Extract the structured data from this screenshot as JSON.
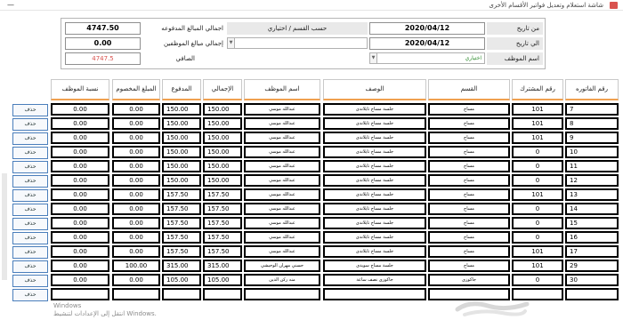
{
  "window": {
    "title": "شاشة استعلام وتعديل فواتير الأقسام الأخرى",
    "minimize": "—"
  },
  "filters": {
    "from_date_label": "من تاريخ",
    "from_date": "2020/04/12",
    "to_date_label": "الي تاريخ",
    "to_date": "2020/04/12",
    "employee_label": "اسم الموظف",
    "employee_combo": "اختياري",
    "section_combo": "حسب القسم / اختياري",
    "emp_combo2": "",
    "total_paid_label": "اجمالي المبالغ المدفوعه",
    "total_paid": "4747.50",
    "total_emp_label": "إجمالي مبالغ الموظفين",
    "total_emp": "0.00",
    "net_label": "الصافي",
    "net": "4747.5"
  },
  "grid": {
    "headers": {
      "invoice_no": "رقم الفاتوره",
      "subscriber_no": "رقم المشترك",
      "section": "القسم",
      "description": "الوصف",
      "employee": "اسم الموظف",
      "total": "الإجمالي",
      "paid": "المدفوع",
      "discount": "المبلغ المخصوم",
      "emp_percent": "نسبة الموظف"
    },
    "delete_label": "حذف",
    "rows": [
      {
        "invoice_no": "7",
        "subscriber_no": "101",
        "section": "مساج",
        "description": "جلسة مساج تايلاندى",
        "employee": "عبدالله موسي",
        "total": "150.00",
        "paid": "150.00",
        "discount": "0.00",
        "emp_percent": "0.00"
      },
      {
        "invoice_no": "8",
        "subscriber_no": "101",
        "section": "مساج",
        "description": "جلسة مساج تايلاندى",
        "employee": "عبدالله موسي",
        "total": "150.00",
        "paid": "150.00",
        "discount": "0.00",
        "emp_percent": "0.00"
      },
      {
        "invoice_no": "9",
        "subscriber_no": "101",
        "section": "مساج",
        "description": "جلسة مساج تايلاندى",
        "employee": "عبدالله موسي",
        "total": "150.00",
        "paid": "150.00",
        "discount": "0.00",
        "emp_percent": "0.00"
      },
      {
        "invoice_no": "10",
        "subscriber_no": "0",
        "section": "مساج",
        "description": "جلسة مساج تايلاندى",
        "employee": "عبدالله موسي",
        "total": "150.00",
        "paid": "150.00",
        "discount": "0.00",
        "emp_percent": "0.00"
      },
      {
        "invoice_no": "11",
        "subscriber_no": "0",
        "section": "مساج",
        "description": "جلسة مساج تايلاندى",
        "employee": "عبدالله موسي",
        "total": "150.00",
        "paid": "150.00",
        "discount": "0.00",
        "emp_percent": "0.00"
      },
      {
        "invoice_no": "12",
        "subscriber_no": "0",
        "section": "مساج",
        "description": "جلسة مساج تايلاندى",
        "employee": "عبدالله موسي",
        "total": "150.00",
        "paid": "150.00",
        "discount": "0.00",
        "emp_percent": "0.00"
      },
      {
        "invoice_no": "13",
        "subscriber_no": "101",
        "section": "مساج",
        "description": "جلسة مساج تايلاندى",
        "employee": "عبدالله موسي",
        "total": "157.50",
        "paid": "157.50",
        "discount": "0.00",
        "emp_percent": "0.00"
      },
      {
        "invoice_no": "14",
        "subscriber_no": "0",
        "section": "مساج",
        "description": "جلسة مساج تايلاندى",
        "employee": "عبدالله موسي",
        "total": "157.50",
        "paid": "157.50",
        "discount": "0.00",
        "emp_percent": "0.00"
      },
      {
        "invoice_no": "15",
        "subscriber_no": "0",
        "section": "مساج",
        "description": "جلسة مساج تايلاندى",
        "employee": "عبدالله موسي",
        "total": "157.50",
        "paid": "157.50",
        "discount": "0.00",
        "emp_percent": "0.00"
      },
      {
        "invoice_no": "16",
        "subscriber_no": "0",
        "section": "مساج",
        "description": "جلسة مساج تايلاندى",
        "employee": "عبدالله موسي",
        "total": "157.50",
        "paid": "157.50",
        "discount": "0.00",
        "emp_percent": "0.00"
      },
      {
        "invoice_no": "17",
        "subscriber_no": "101",
        "section": "مساج",
        "description": "جلسة مساج تايلاندى",
        "employee": "عبدالله موسي",
        "total": "157.50",
        "paid": "157.50",
        "discount": "0.00",
        "emp_percent": "0.00"
      },
      {
        "invoice_no": "29",
        "subscriber_no": "101",
        "section": "مساج",
        "description": "جلسة مساج سويدى",
        "employee": "حسني مهران الوحيشي",
        "total": "315.00",
        "paid": "315.00",
        "discount": "100.00",
        "emp_percent": "0.00"
      },
      {
        "invoice_no": "30",
        "subscriber_no": "0",
        "section": "جاكوزى",
        "description": "جاكوزى نصف ساعة",
        "employee": "منه ركن الدين",
        "total": "105.00",
        "paid": "105.00",
        "discount": "0.00",
        "emp_percent": "0.00"
      },
      {
        "invoice_no": "",
        "subscriber_no": "",
        "section": "",
        "description": "",
        "employee": "",
        "total": "",
        "paid": "",
        "discount": "",
        "emp_percent": ""
      }
    ]
  },
  "watermark": {
    "line1": "Windows",
    "line2": "انتقل إلى الإعدادات لتنشيط Windows."
  },
  "colors": {
    "header_accent": "#f0a050",
    "net_value": "#d9534f",
    "combo_text": "#2e8b2e",
    "button_border": "#4a7ebb"
  }
}
